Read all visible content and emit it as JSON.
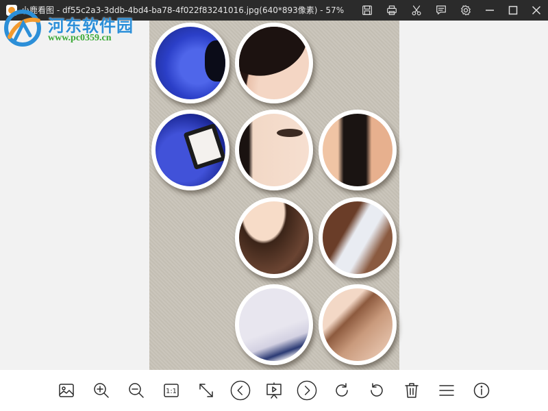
{
  "window": {
    "app_name": "小鹿看图",
    "title": "小鹿看图 - df55c2a3-3ddb-4bd4-ba78-4f022f83241016.jpg(640*893像素) - 57%",
    "actions": [
      {
        "name": "save-icon"
      },
      {
        "name": "print-icon"
      },
      {
        "name": "cut-icon"
      },
      {
        "name": "comment-icon"
      },
      {
        "name": "settings-icon"
      }
    ],
    "controls": [
      {
        "name": "minimize-icon"
      },
      {
        "name": "maximize-icon"
      },
      {
        "name": "close-icon"
      }
    ]
  },
  "watermark": {
    "name": "河东软件园",
    "url": "www.pc0359.cn",
    "colors": {
      "name": "#2c8fd8",
      "url": "#3aa836"
    }
  },
  "image": {
    "filename": "df55c2a3-3ddb-4bd4-ba78-4f022f83241016.jpg",
    "dimensions": "640*893像素",
    "zoom": "57%",
    "background_color": "#c9c4b9"
  },
  "toolbar": {
    "one_to_one_label": "1:1",
    "tools": [
      "image-icon",
      "zoom-in-icon",
      "zoom-out-icon",
      "actual-size-icon",
      "fit-screen-icon",
      "previous-icon",
      "slideshow-icon",
      "next-icon",
      "rotate-clockwise-icon",
      "rotate-counterclockwise-icon",
      "delete-icon",
      "menu-icon",
      "info-icon"
    ]
  }
}
